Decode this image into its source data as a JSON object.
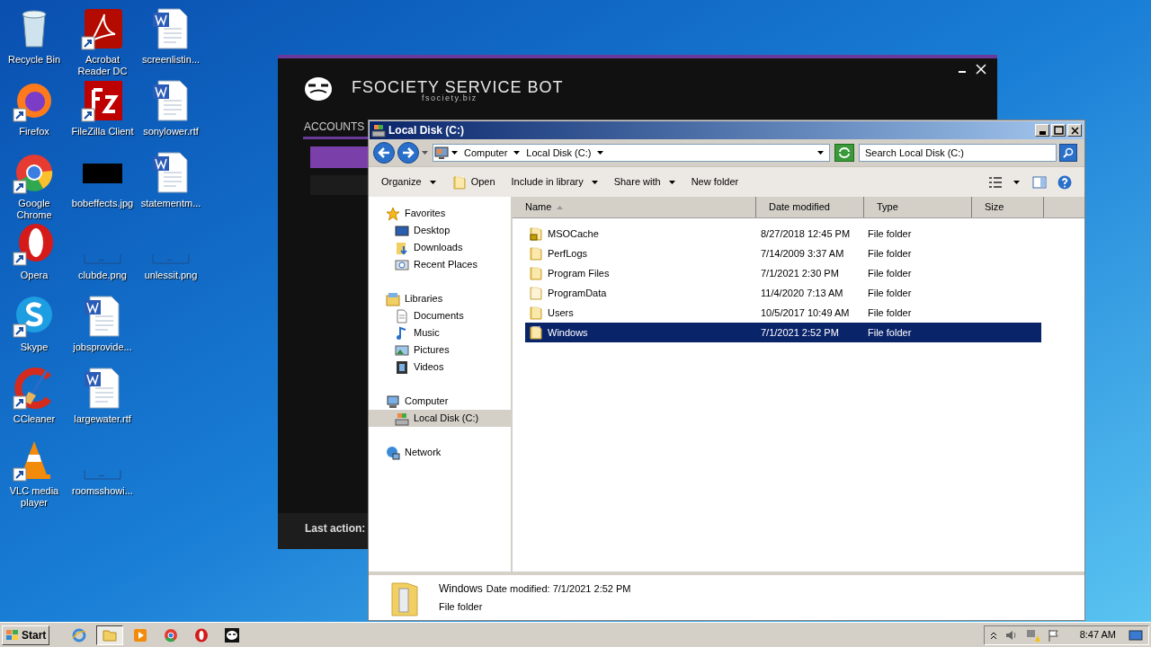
{
  "desktop_icons": [
    {
      "label": "Recycle Bin",
      "kind": "recycle"
    },
    {
      "label": "Firefox",
      "kind": "firefox"
    },
    {
      "label": "Google Chrome",
      "kind": "chrome"
    },
    {
      "label": "Opera",
      "kind": "opera"
    },
    {
      "label": "Skype",
      "kind": "skype"
    },
    {
      "label": "CCleaner",
      "kind": "ccleaner"
    },
    {
      "label": "VLC media player",
      "kind": "vlc"
    },
    {
      "label": "Acrobat Reader DC",
      "kind": "pdf"
    },
    {
      "label": "FileZilla Client",
      "kind": "filezilla"
    },
    {
      "label": "bobeffects.jpg",
      "kind": "dark-image"
    },
    {
      "label": "clubde.png",
      "kind": "blank-image"
    },
    {
      "label": "jobsprovide...",
      "kind": "word"
    },
    {
      "label": "largewater.rtf",
      "kind": "word"
    },
    {
      "label": "roomsshowi...",
      "kind": "blank-image"
    },
    {
      "label": "screenlistin...",
      "kind": "word"
    },
    {
      "label": "sonylower.rtf",
      "kind": "word"
    },
    {
      "label": "statementm...",
      "kind": "word"
    },
    {
      "label": "unlessit.png",
      "kind": "blank-image"
    }
  ],
  "bot_window": {
    "title": "FSOCIETY SERVICE BOT",
    "subtitle": "fsociety.biz",
    "tab": "ACCOUNTS",
    "status": "Last action:"
  },
  "explorer": {
    "title": "Local Disk (C:)",
    "breadcrumb": [
      "Computer",
      "Local Disk (C:)"
    ],
    "search": {
      "placeholder": "Search Local Disk (C:)"
    },
    "toolbar": [
      {
        "label": "Organize",
        "dropdown": true,
        "kind": "text"
      },
      {
        "label": "Open",
        "dropdown": false,
        "kind": "open"
      },
      {
        "label": "Include in library",
        "dropdown": true,
        "kind": "text"
      },
      {
        "label": "Share with",
        "dropdown": true,
        "kind": "text"
      },
      {
        "label": "New folder",
        "dropdown": false,
        "kind": "text"
      }
    ],
    "nav": [
      {
        "label": "Favorites",
        "kind": "star",
        "selected": false,
        "children": [
          {
            "label": "Desktop",
            "kind": "desktop",
            "selected": false
          },
          {
            "label": "Downloads",
            "kind": "downloads",
            "selected": false
          },
          {
            "label": "Recent Places",
            "kind": "recent",
            "selected": false
          }
        ]
      },
      {
        "label": "Libraries",
        "kind": "library",
        "selected": false,
        "children": [
          {
            "label": "Documents",
            "kind": "document",
            "selected": false
          },
          {
            "label": "Music",
            "kind": "music",
            "selected": false
          },
          {
            "label": "Pictures",
            "kind": "pictures",
            "selected": false
          },
          {
            "label": "Videos",
            "kind": "videos",
            "selected": false
          }
        ]
      },
      {
        "label": "Computer",
        "kind": "computer",
        "selected": false,
        "children": [
          {
            "label": "Local Disk (C:)",
            "kind": "disk",
            "selected": true
          }
        ]
      },
      {
        "label": "Network",
        "kind": "network",
        "selected": false
      }
    ],
    "columns": [
      "Name",
      "Date modified",
      "Type",
      "Size"
    ],
    "files": [
      {
        "name": "MSOCache",
        "date": "8/27/2018 12:45 PM",
        "type": "File folder",
        "kind": "locked",
        "selected": false
      },
      {
        "name": "PerfLogs",
        "date": "7/14/2009 3:37 AM",
        "type": "File folder",
        "kind": "folder",
        "selected": false
      },
      {
        "name": "Program Files",
        "date": "7/1/2021 2:30 PM",
        "type": "File folder",
        "kind": "folder",
        "selected": false
      },
      {
        "name": "ProgramData",
        "date": "11/4/2020 7:13 AM",
        "type": "File folder",
        "kind": "hidden",
        "selected": false
      },
      {
        "name": "Users",
        "date": "10/5/2017 10:49 AM",
        "type": "File folder",
        "kind": "folder",
        "selected": false
      },
      {
        "name": "Windows",
        "date": "7/1/2021 2:52 PM",
        "type": "File folder",
        "kind": "folder",
        "selected": true
      }
    ],
    "details": {
      "name": "Windows",
      "date_label": "Date modified:",
      "date": "7/1/2021 2:52 PM",
      "type": "File folder"
    }
  },
  "taskbar": {
    "start": "Start",
    "apps": [
      {
        "kind": "ie",
        "active": false
      },
      {
        "kind": "explorer",
        "active": true
      },
      {
        "kind": "media",
        "active": false
      },
      {
        "kind": "chrome",
        "active": false
      },
      {
        "kind": "opera",
        "active": false
      },
      {
        "kind": "mask",
        "active": false
      }
    ],
    "clock": "8:47 AM"
  }
}
